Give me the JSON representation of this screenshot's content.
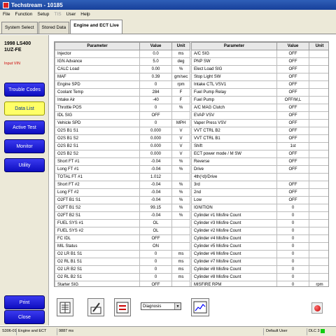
{
  "window": {
    "title": "Techstream - 10185"
  },
  "menu": [
    "File",
    "Function",
    "Setup",
    "TIS",
    "User",
    "Help"
  ],
  "tabs": [
    "System Select",
    "Stored Data",
    "Engine and ECT Live"
  ],
  "vehicle": {
    "line1": "1998 LS400",
    "line2": "1UZ-FE",
    "vin_label": "Input VIN"
  },
  "nav": {
    "trouble_codes": "Trouble Codes",
    "data_list": "Data List",
    "active_test": "Active Test",
    "monitor": "Monitor",
    "utility": "Utility",
    "print": "Print",
    "close": "Close"
  },
  "table_headers": {
    "parameter": "Parameter",
    "value": "Value",
    "unit": "Unit"
  },
  "left_rows": [
    [
      "Injector",
      "0.0",
      "ms"
    ],
    [
      "IGN Advance",
      "5.0",
      "deg"
    ],
    [
      "CALC Load",
      "0.00",
      "%"
    ],
    [
      "MAF",
      "0.39",
      "gm/sec"
    ],
    [
      "Engine SPD",
      "0",
      "rpm"
    ],
    [
      "Coolant Temp",
      "284",
      "F"
    ],
    [
      "Intake Air",
      "-40",
      "F"
    ],
    [
      "Throttle POS",
      "0",
      "%"
    ],
    [
      "IDL SIG",
      "OFF",
      ""
    ],
    [
      "Vehicle SPD",
      "0",
      "MPH"
    ],
    [
      "O2S B1 S1",
      "0.000",
      "V"
    ],
    [
      "O2S B1 S2",
      "0.000",
      "V"
    ],
    [
      "O2S B2 S1",
      "0.000",
      "V"
    ],
    [
      "O2S B2 S2",
      "0.000",
      "V"
    ],
    [
      "Short FT #1",
      "-0.04",
      "%"
    ],
    [
      "Long FT #1",
      "-0.04",
      "%"
    ],
    [
      "TOTAL FT #1",
      "1.012",
      ""
    ],
    [
      "Short FT #2",
      "-0.04",
      "%"
    ],
    [
      "Long FT #2",
      "-0.04",
      "%"
    ],
    [
      "O2FT B1 S1",
      "-0.04",
      "%"
    ],
    [
      "O2FT B1 S2",
      "99.15",
      "%"
    ],
    [
      "O2FT B2 S1",
      "-0.04",
      "%"
    ],
    [
      "FUEL SYS #1",
      "OL",
      ""
    ],
    [
      "FUEL SYS #2",
      "OL",
      ""
    ],
    [
      "FC IDL",
      "OFF",
      ""
    ],
    [
      "MIL Status",
      "ON",
      ""
    ],
    [
      "O2 LR B1 S1",
      "0",
      "ms"
    ],
    [
      "O2 RL B1 S1",
      "0",
      "ms"
    ],
    [
      "O2 LR B2 S1",
      "0",
      "ms"
    ],
    [
      "O2 RL B2 S1",
      "0",
      "ms"
    ],
    [
      "Starter SIG",
      "OFF",
      ""
    ]
  ],
  "right_rows": [
    [
      "A/C SIG",
      "OFF",
      ""
    ],
    [
      "PNP SW",
      "OFF",
      ""
    ],
    [
      "Elect Load SIG",
      "OFF",
      ""
    ],
    [
      "Stop Light SW",
      "OFF",
      ""
    ],
    [
      "Intake CTL VSV1",
      "OFF",
      ""
    ],
    [
      "Fuel Pump Relay",
      "OFF",
      ""
    ],
    [
      "Fuel Pump",
      "OFF/M,L",
      ""
    ],
    [
      "A/C MAG Clutch",
      "OFF",
      ""
    ],
    [
      "EVAP VSV",
      "OFF",
      ""
    ],
    [
      "Vaper Press VSV",
      "OFF",
      ""
    ],
    [
      "VVT CTRL B2",
      "OFF",
      ""
    ],
    [
      "VVT CTRL B1",
      "OFF",
      ""
    ],
    [
      "Shift",
      "1st",
      ""
    ],
    [
      "ECT power mode / M SW",
      "OFF",
      ""
    ],
    [
      "Reverse",
      "OFF",
      ""
    ],
    [
      "Drive",
      "OFF",
      ""
    ],
    [
      "4th(¹d)/Drive",
      "",
      ""
    ],
    [
      "3rd",
      "OFF",
      ""
    ],
    [
      "2nd",
      "OFF",
      ""
    ],
    [
      "Low",
      "OFF",
      ""
    ],
    [
      "IGNITION",
      "0",
      ""
    ],
    [
      "Cylinder #1 Misfire Count",
      "0",
      ""
    ],
    [
      "Cylinder #3 Misfire Count",
      "0",
      ""
    ],
    [
      "Cylinder #2 Misfire Count",
      "0",
      ""
    ],
    [
      "Cylinder #4 Misfire Count",
      "0",
      ""
    ],
    [
      "Cylinder #5 Misfire Count",
      "0",
      ""
    ],
    [
      "Cylinder #6 Misfire Count",
      "0",
      ""
    ],
    [
      "Cylinder #7 Misfire Count",
      "0",
      ""
    ],
    [
      "Cylinder #8 Misfire Count",
      "0",
      ""
    ],
    [
      "Cylinder #8 Misfire Count",
      "0",
      ""
    ],
    [
      "MISFIRE RPM",
      "0",
      "rpm"
    ]
  ],
  "toolbar": {
    "mode_select": "Diagnosis"
  },
  "status": {
    "device": "S306-01",
    "system": "Engine and ECT",
    "time": "9887 ms",
    "user": "Default User",
    "dlc": "DLC 3"
  },
  "colors": {
    "title_bar": "#1f4fa8",
    "nav_button": "#1515d9",
    "nav_active": "#ffff66",
    "status_ok": "#11cc11"
  }
}
